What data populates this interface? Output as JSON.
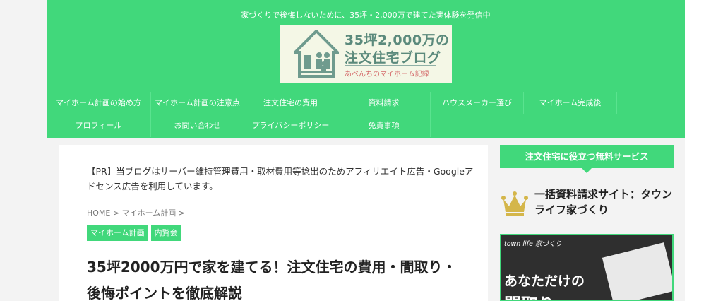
{
  "header": {
    "tagline": "家づくりで後悔しないために、35坪・2,000万で建てた実体験を発信中",
    "logo_line1": "35坪2,000万の",
    "logo_line2": "注文住宅ブログ",
    "logo_line3": "あべんちのマイホーム記録"
  },
  "nav": {
    "row1": [
      "マイホーム計画の始め方",
      "マイホーム計画の注意点",
      "注文住宅の費用",
      "資料請求",
      "ハウスメーカー選び",
      "マイホーム完成後"
    ],
    "row2": [
      "プロフィール",
      "お問い合わせ",
      "プライバシーポリシー",
      "免責事項"
    ]
  },
  "article": {
    "pr_notice": "【PR】当ブログはサーバー維持管理費用・取材費用等捻出のためアフィリエイト広告・Googleアドセンス広告を利用しています。",
    "breadcrumb": "HOME > マイホーム計画 >",
    "tags": [
      "マイホーム計画",
      "内覧会"
    ],
    "title": "35坪2000万円で家を建てる！注文住宅の費用・間取り・後悔ポイントを徹底解説"
  },
  "sidebar": {
    "heading": "注文住宅に役立つ無料サービス",
    "item_title": "一括資料請求サイト：タウンライフ家づくり",
    "banner_brand": "town life 家づくり",
    "banner_text1": "あなただけの",
    "banner_text2": "間取り"
  },
  "colors": {
    "accent": "#41d87b",
    "background": "#f3f3f3",
    "logo_text": "#5b8a7c"
  }
}
